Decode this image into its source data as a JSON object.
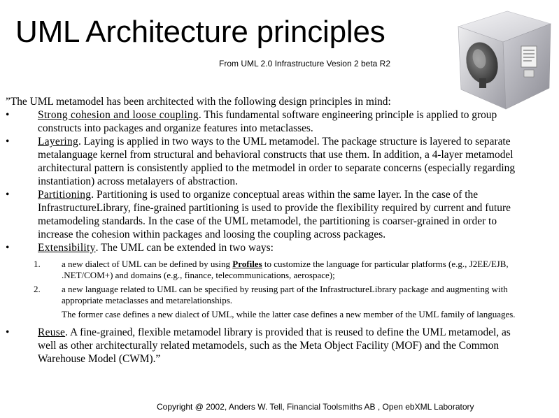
{
  "slide": {
    "title": "UML Architecture principles",
    "subtitle": "From UML 2.0 Infrastructure  Vesion 2 beta R2",
    "logo_icon": "cube-with-satellite-dish-icon",
    "intro": "”The UML metamodel has been architected with the following design principles in mind:",
    "bullet_glyph": "•",
    "principles": [
      {
        "term": "Strong cohesion and loose coupling",
        "text": ". This fundamental software engineering principle is applied to group constructs into packages and organize features into metaclasses."
      },
      {
        "term": "Layering",
        "text": ". Laying is applied in two ways to the UML metamodel. The package structure is layered to separate metalanguage kernel from structural and behavioral constructs that use them. In addition, a 4-layer metamodel architectural pattern is consistently applied to the metmodel in order to separate concerns (especially regarding instantiation) across metalayers of abstraction."
      },
      {
        "term": "Partitioning",
        "text": ". Partitioning is used to organize conceptual areas within the same layer. In the case of the InfrastructureLibrary, fine-grained partitioning is used to provide the flexibility required by current and future metamodeling standards. In the case of the UML metamodel, the partitioning is coarser-grained in order to increase the cohesion within packages and loosing the coupling across packages."
      },
      {
        "term": "Extensibility",
        "text": ". The UML can be extended in two ways:",
        "ways": [
          {
            "num": "1.",
            "pre": "a new dialect of UML can be defined by using ",
            "link": "Profiles",
            "post": " to customize the language for particular platforms (e.g., J2EE/EJB, .NET/COM+) and domains (e.g., finance, telecommunications, aerospace);"
          },
          {
            "num": "2.",
            "pre": "a new language related to UML can be specified by reusing part of the InfrastructureLibrary package and augmenting with appropriate metaclasses and metarelationships.",
            "link": "",
            "post": ""
          }
        ],
        "note": "The former case defines a new dialect of UML, while the latter case defines a new member of the UML family of languages."
      },
      {
        "term": "Reuse",
        "text": ". A fine-grained, flexible metamodel library is provided that is reused to define the UML metamodel, as well as other architecturally related metamodels, such as the Meta Object Facility (MOF) and the Common Warehouse Model (CWM).”"
      }
    ],
    "footer": "Copyright @ 2002, Anders W. Tell, Financial Toolsmiths AB , Open ebXML Laboratory"
  }
}
